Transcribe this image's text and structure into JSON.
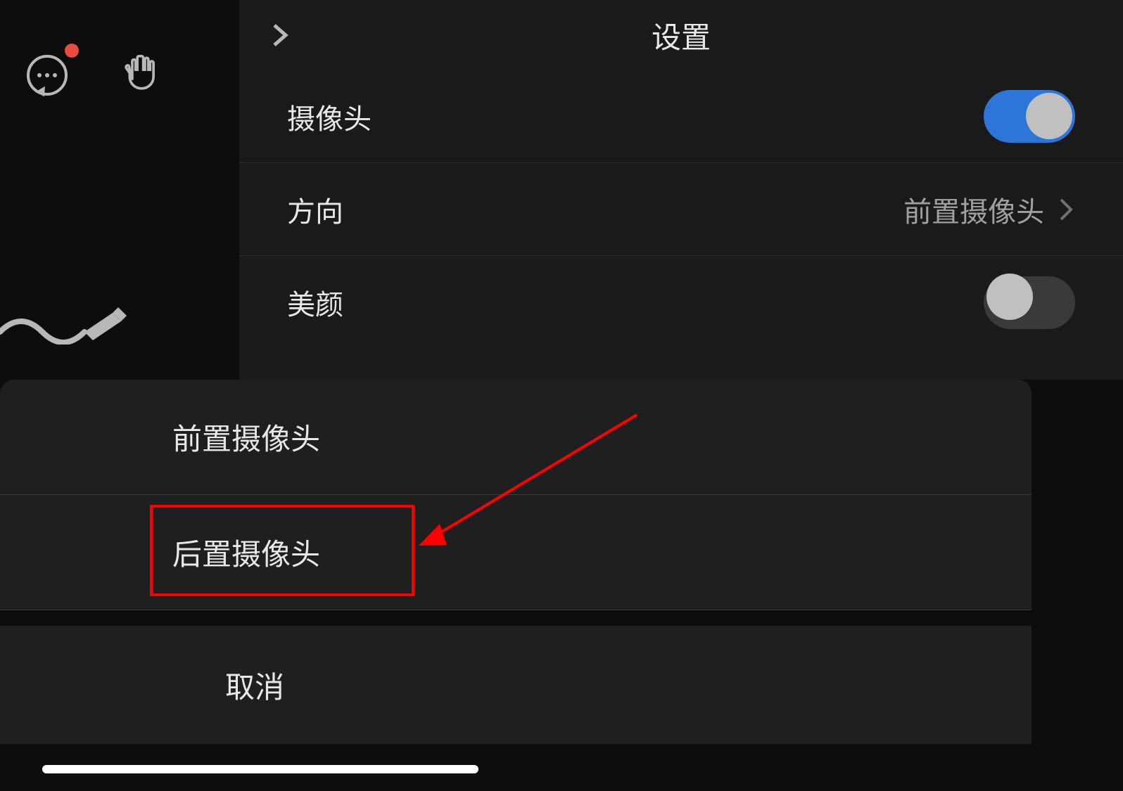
{
  "header": {
    "title": "设置"
  },
  "settings": {
    "camera": {
      "label": "摄像头",
      "enabled": true
    },
    "direction": {
      "label": "方向",
      "value": "前置摄像头"
    },
    "beauty": {
      "label": "美颜",
      "enabled": false
    }
  },
  "actionSheet": {
    "options": [
      "前置摄像头",
      "后置摄像头"
    ],
    "cancel": "取消"
  },
  "annotation": {
    "highlightColor": "#ff0000"
  }
}
